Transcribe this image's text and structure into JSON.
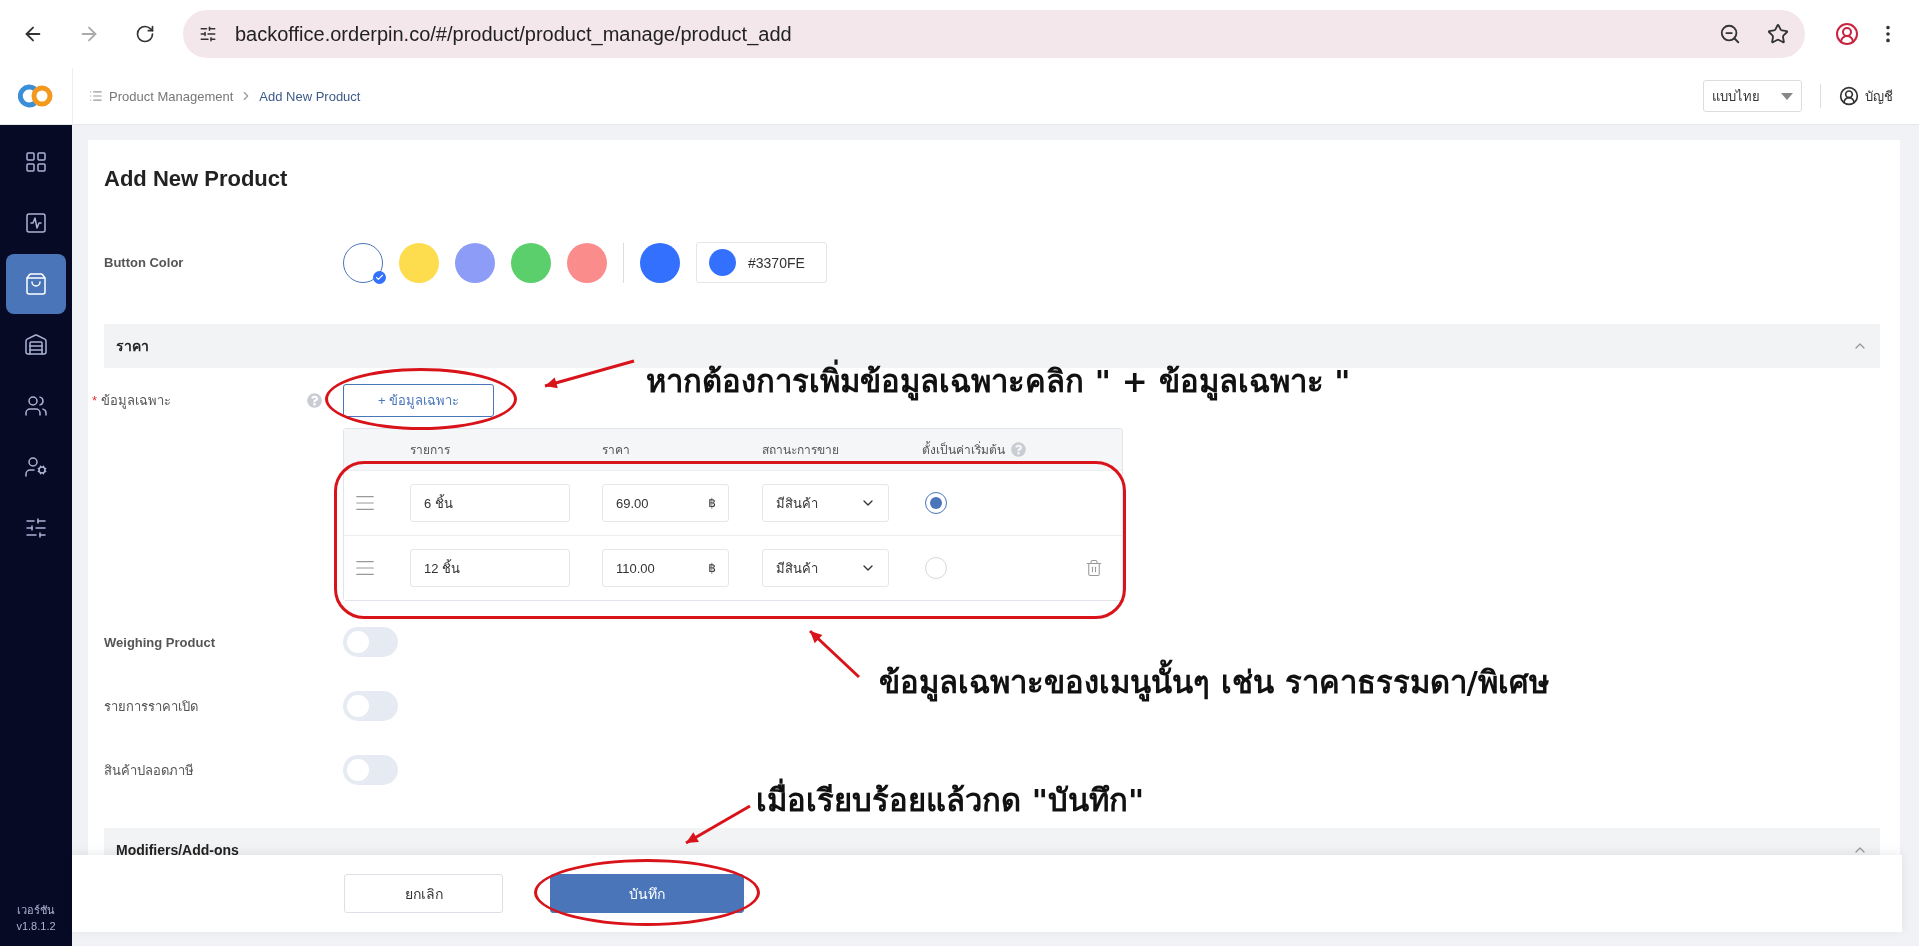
{
  "browser": {
    "url": "backoffice.orderpin.co/#/product/product_manage/product_add"
  },
  "header": {
    "breadcrumb": [
      {
        "label": "Product Management"
      },
      {
        "label": "Add New Product"
      }
    ],
    "language": "แบบไทย",
    "account": "บัญชี"
  },
  "sidebar": {
    "items": [
      {
        "selected": false
      },
      {
        "selected": false
      },
      {
        "selected": true
      },
      {
        "selected": false
      },
      {
        "selected": false
      },
      {
        "selected": false
      },
      {
        "selected": false
      }
    ],
    "version_label": "เวอร์ชัน",
    "version": "v1.8.1.2"
  },
  "page": {
    "title": "Add New Product",
    "button_color": {
      "label": "Button Color",
      "swatches": [
        {
          "color": "#ffffff",
          "selected": true
        },
        {
          "color": "#fddc4e",
          "selected": false
        },
        {
          "color": "#8c9cf7",
          "selected": false
        },
        {
          "color": "#5bcf6b",
          "selected": false
        },
        {
          "color": "#fb8c8c",
          "selected": false
        }
      ],
      "custom": {
        "color": "#3370fe",
        "value": "#3370FE"
      }
    },
    "price_section": {
      "title": "ราคา",
      "expanded": true
    },
    "variants": {
      "label": "ข้อมูลเฉพาะ",
      "required_mark": "*",
      "add_button": "+ ข้อมูลเฉพาะ",
      "columns": [
        "รายการ",
        "ราคา",
        "สถานะการขาย",
        "ตั้งเป็นค่าเริ่มต้น"
      ],
      "rows": [
        {
          "name": "6 ชิ้น",
          "price": "69.00",
          "currency": "฿",
          "status": "มีสินค้า",
          "default": true,
          "deletable": false
        },
        {
          "name": "12 ชิ้น",
          "price": "110.00",
          "currency": "฿",
          "status": "มีสินค้า",
          "default": false,
          "deletable": true
        }
      ]
    },
    "toggles": [
      {
        "label": "Weighing Product",
        "on": false
      },
      {
        "label": "รายการราคาเปิด",
        "on": false
      },
      {
        "label": "สินค้าปลอดภาษี",
        "on": false
      }
    ],
    "modifiers_section": {
      "title": "Modifiers/Add-ons",
      "expanded": true
    }
  },
  "footer": {
    "cancel": "ยกเลิก",
    "save": "บันทึก"
  },
  "annotations": [
    {
      "text": "หากต้องการเพิ่มข้อมูลเฉพาะคลิก \" + ข้อมูลเฉพาะ \""
    },
    {
      "text": "ข้อมูลเฉพาะของเมนูนั้นๆ เช่น ราคาธรรมดา/พิเศษ"
    },
    {
      "text": "เมื่อเรียบร้อยแล้วกด \"บันทึก\""
    }
  ]
}
